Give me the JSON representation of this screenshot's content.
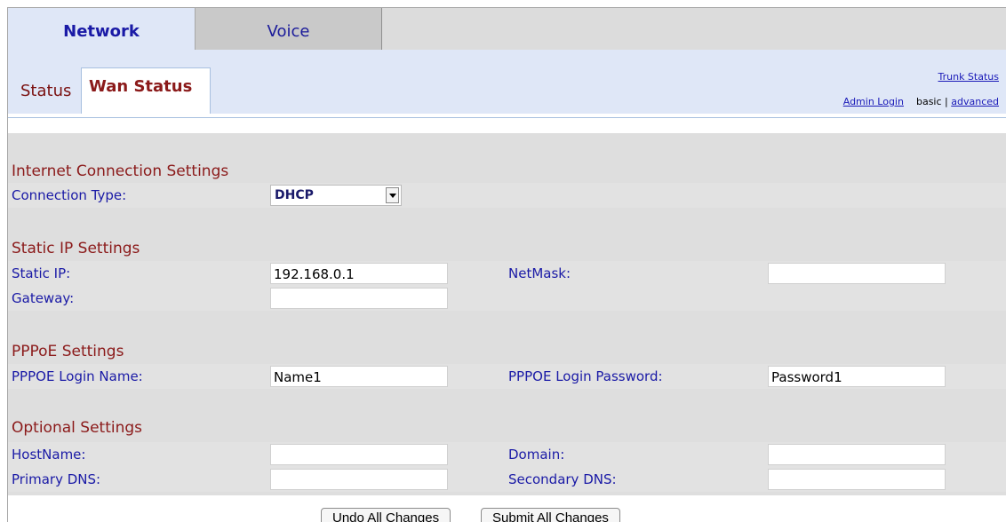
{
  "tabs": {
    "network": "Network",
    "voice": "Voice"
  },
  "subtabs": {
    "status": "Status",
    "wan_status": "Wan Status"
  },
  "links": {
    "trunk_status": "Trunk Status",
    "admin_login": "Admin Login",
    "basic": "basic",
    "sep": "|",
    "advanced": "advanced"
  },
  "sections": {
    "internet": {
      "title": "Internet Connection Settings",
      "connection_type_label": "Connection Type:",
      "connection_type_value": "DHCP"
    },
    "static": {
      "title": "Static IP Settings",
      "static_ip_label": "Static IP:",
      "static_ip_value": "192.168.0.1",
      "netmask_label": "NetMask:",
      "netmask_value": "",
      "gateway_label": "Gateway:",
      "gateway_value": ""
    },
    "pppoe": {
      "title": "PPPoE Settings",
      "login_name_label": "PPPOE Login Name:",
      "login_name_value": "Name1",
      "login_password_label": "PPPOE Login Password:",
      "login_password_value": "Password1"
    },
    "optional": {
      "title": "Optional Settings",
      "hostname_label": "HostName:",
      "hostname_value": "",
      "domain_label": "Domain:",
      "domain_value": "",
      "primary_dns_label": "Primary DNS:",
      "primary_dns_value": "",
      "secondary_dns_label": "Secondary DNS:",
      "secondary_dns_value": ""
    }
  },
  "buttons": {
    "undo": "Undo All Changes",
    "submit": "Submit All Changes"
  }
}
